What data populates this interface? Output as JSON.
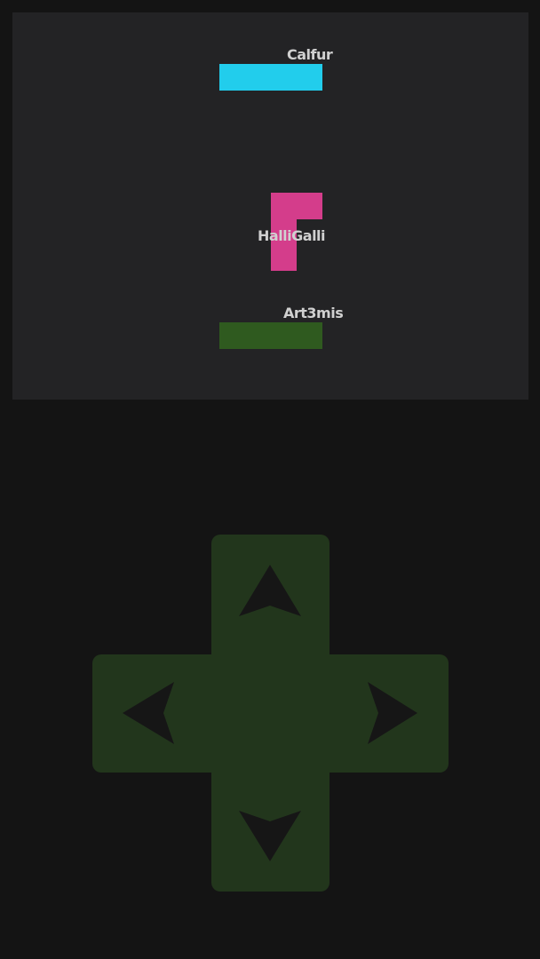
{
  "board": {
    "background": "#232325"
  },
  "players": [
    {
      "name": "Calfur",
      "color": "#22cdec"
    },
    {
      "name": "HalliGalli",
      "color": "#d43d8b"
    },
    {
      "name": "Art3mis",
      "color": "#2f5a1f"
    }
  ],
  "dpad": {
    "color": "#22361c",
    "arrow_color": "#161616",
    "buttons": [
      "up",
      "left",
      "right",
      "down"
    ]
  }
}
